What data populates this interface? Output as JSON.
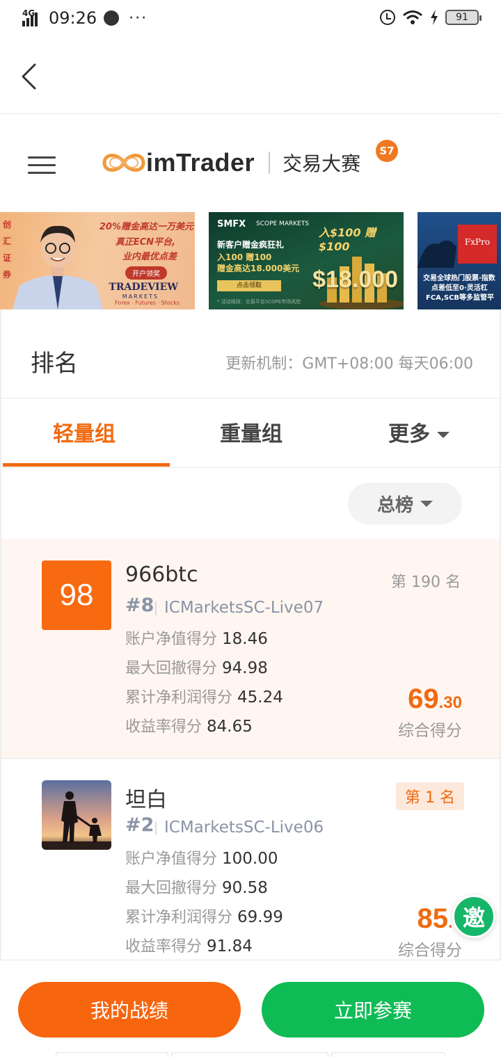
{
  "status_bar": {
    "network": "4G",
    "time": "09:26",
    "more": "···",
    "battery": "91"
  },
  "header": {
    "brand_name": "imTrader",
    "brand_sub": "交易大赛",
    "season_badge": "S7"
  },
  "banners": [
    {
      "side_text": [
        "创",
        "汇",
        "证",
        "券"
      ],
      "line1": "20%赠金高达一万美元",
      "line2": "真正ECN平台,",
      "line3": "业内最优点差",
      "button": "开户领奖",
      "brand": "TRADEVIEW",
      "brand_sub": "MARKETS",
      "brand_tag": "Forex · Futures · Stocks"
    },
    {
      "brand": "SMFX",
      "partner": "SCOPE MARKETS",
      "headline": "入$100 赠$100",
      "line1": "新客户赠金疯狂礼",
      "line2": "入100 赠100",
      "line3": "赠金高达18.000美元",
      "button": "点击领取",
      "big": "$18.000",
      "fine_print": "* 活动规则：交易平台SCOPE市场风险"
    },
    {
      "brand": "FxPro",
      "line1": "交易全球热门股票·指数",
      "line2": "点差低至0·灵活杠",
      "line3": "FCA,SCB等多监管平"
    }
  ],
  "ranking": {
    "title": "排名",
    "update_note": "更新机制：GMT+08:00 每天06:00"
  },
  "tabs": [
    {
      "label": "轻量组",
      "active": true
    },
    {
      "label": "重量组",
      "active": false
    },
    {
      "label": "更多",
      "active": false
    }
  ],
  "filter": {
    "label": "总榜"
  },
  "entries": [
    {
      "score_box": "98",
      "name": "966btc",
      "rank_no": "#8",
      "server": "ICMarketsSC-Live07",
      "place": "第 190 名",
      "metrics": [
        {
          "label": "账户净值得分",
          "value": "18.46"
        },
        {
          "label": "最大回撤得分",
          "value": "94.98"
        },
        {
          "label": "累计净利润得分",
          "value": "45.24"
        },
        {
          "label": "收益率得分",
          "value": "84.65"
        }
      ],
      "total_int": "69",
      "total_dec": ".30",
      "total_label": "综合得分"
    },
    {
      "name": "坦白",
      "rank_no": "#2",
      "server": "ICMarketsSC-Live06",
      "place": "第 1 名",
      "metrics": [
        {
          "label": "账户净值得分",
          "value": "100.00"
        },
        {
          "label": "最大回撤得分",
          "value": "90.58"
        },
        {
          "label": "累计净利润得分",
          "value": "69.99"
        },
        {
          "label": "收益率得分",
          "value": "91.84"
        }
      ],
      "total_int": "85",
      "total_dec": ".7",
      "total_label": "综合得分"
    }
  ],
  "invite_label": "邀",
  "bottom_bar": {
    "my_record": "我的战绩",
    "join_now": "立即参赛"
  },
  "colors": {
    "accent_orange": "#f06a0f",
    "join_green": "#0fbb55"
  }
}
